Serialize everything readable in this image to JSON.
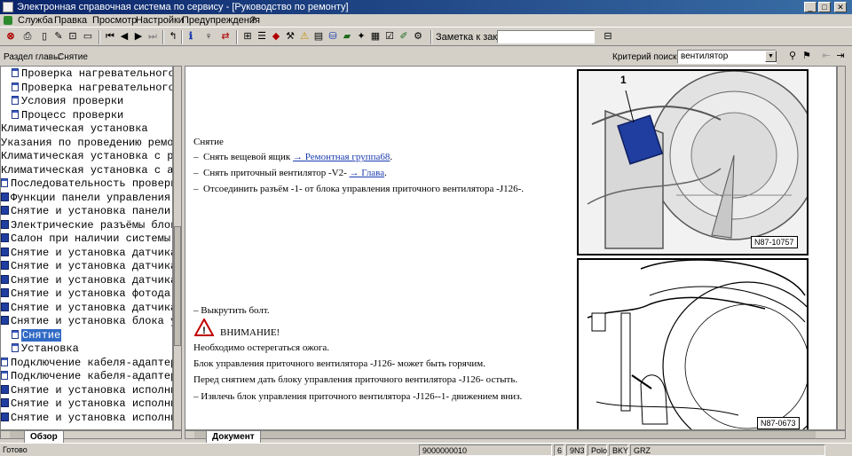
{
  "window": {
    "title": "Электронная справочная система по сервису - [Руководство по ремонту]",
    "controls": {
      "minimize": "_",
      "maximize": "□",
      "close": "✕"
    }
  },
  "menu": {
    "items": [
      "Служба",
      "Правка",
      "Просмотр",
      "Настройки",
      "Предупреждения",
      "?"
    ]
  },
  "toolbar": {
    "order_note_label": "Заметка к заказу:",
    "order_note_value": ""
  },
  "section": {
    "label": "Раздел главы:",
    "value": "Снятие"
  },
  "search": {
    "criterion_label": "Критерий поиска:",
    "value": "вентилятор"
  },
  "tree": {
    "items": [
      {
        "label": "Проверка нагревательного",
        "icon": "doc-icon",
        "indent": 1
      },
      {
        "label": "Проверка нагревательного",
        "icon": "doc-icon",
        "indent": 1
      },
      {
        "label": "Условия проверки",
        "icon": "doc-icon",
        "indent": 1
      },
      {
        "label": "Процесс проверки",
        "icon": "doc-icon",
        "indent": 1
      },
      {
        "label": "Климатическая установка",
        "icon": "none",
        "indent": 0
      },
      {
        "label": "Указания по проведению ремо",
        "icon": "none",
        "indent": 0
      },
      {
        "label": "Климатическая установка с ру",
        "icon": "none",
        "indent": 0
      },
      {
        "label": "Климатическая установка с ав",
        "icon": "none",
        "indent": 0
      },
      {
        "label": "Последовательность проверк",
        "icon": "doc-icon",
        "indent": 0
      },
      {
        "label": "Функции панели управления",
        "icon": "book-icon",
        "indent": 0
      },
      {
        "label": "Снятие и установка панели",
        "icon": "book-icon",
        "indent": 0
      },
      {
        "label": "Электрические разъёмы блок",
        "icon": "book-icon",
        "indent": 0
      },
      {
        "label": "Салон при наличии системы",
        "icon": "book-icon",
        "indent": 0
      },
      {
        "label": "Снятие и установка датчика",
        "icon": "book-icon",
        "indent": 0
      },
      {
        "label": "Снятие и установка датчика",
        "icon": "book-icon",
        "indent": 0
      },
      {
        "label": "Снятие и установка датчика",
        "icon": "book-icon",
        "indent": 0
      },
      {
        "label": "Снятие и установка фотода",
        "icon": "book-icon",
        "indent": 0
      },
      {
        "label": "Снятие и установка датчика",
        "icon": "book-icon",
        "indent": 0
      },
      {
        "label": "Снятие и установка блока у",
        "icon": "book-icon",
        "indent": 0
      },
      {
        "label": "Снятие",
        "icon": "doc-icon",
        "indent": 1,
        "selected": true
      },
      {
        "label": "Установка",
        "icon": "doc-icon",
        "indent": 1
      },
      {
        "label": "Подключение кабеля-адаптер",
        "icon": "doc-icon",
        "indent": 0
      },
      {
        "label": "Подключение кабеля-адаптер",
        "icon": "doc-icon",
        "indent": 0
      },
      {
        "label": "Снятие и установка исполни",
        "icon": "book-icon",
        "indent": 0
      },
      {
        "label": "Снятие и установка исполни",
        "icon": "book-icon",
        "indent": 0
      },
      {
        "label": "Снятие и установка исполни",
        "icon": "book-icon",
        "indent": 0
      }
    ],
    "tab": "Обзор"
  },
  "document": {
    "tab": "Документ",
    "heading": "Снятие",
    "steps_top": [
      {
        "bullet": "–",
        "text": "Снять вещевой ящик",
        "link": "→ Ремонтная группа68",
        "after": "."
      },
      {
        "bullet": "–",
        "text": "Снять приточный вентилятор -V2-",
        "link": "→ Глава",
        "after": "."
      },
      {
        "bullet": "–",
        "text": "Отсоединить разъём -1- от блока управления приточного вентилятора -J126-.",
        "link": "",
        "after": ""
      }
    ],
    "step_bolt": "–  Выкрутить болт.",
    "warning_title": "ВНИМАНИЕ!",
    "warning_lines": [
      "Необходимо остерегаться ожога.",
      "Блок управления приточного вентилятора -J126- может быть горячим.",
      "Перед снятием дать блоку управления приточного вентилятора -J126- остыть."
    ],
    "step_remove": "–  Извлечь блок управления приточного вентилятора -J126--1- движением вниз.",
    "figures": [
      {
        "callout": "1",
        "label": "N87-10757"
      },
      {
        "label": "N87-0673"
      }
    ]
  },
  "status": {
    "ready": "Готово",
    "code": "9000000010",
    "fields": [
      "6",
      "9N3",
      "Polo",
      "BKY",
      "GRZ"
    ]
  }
}
